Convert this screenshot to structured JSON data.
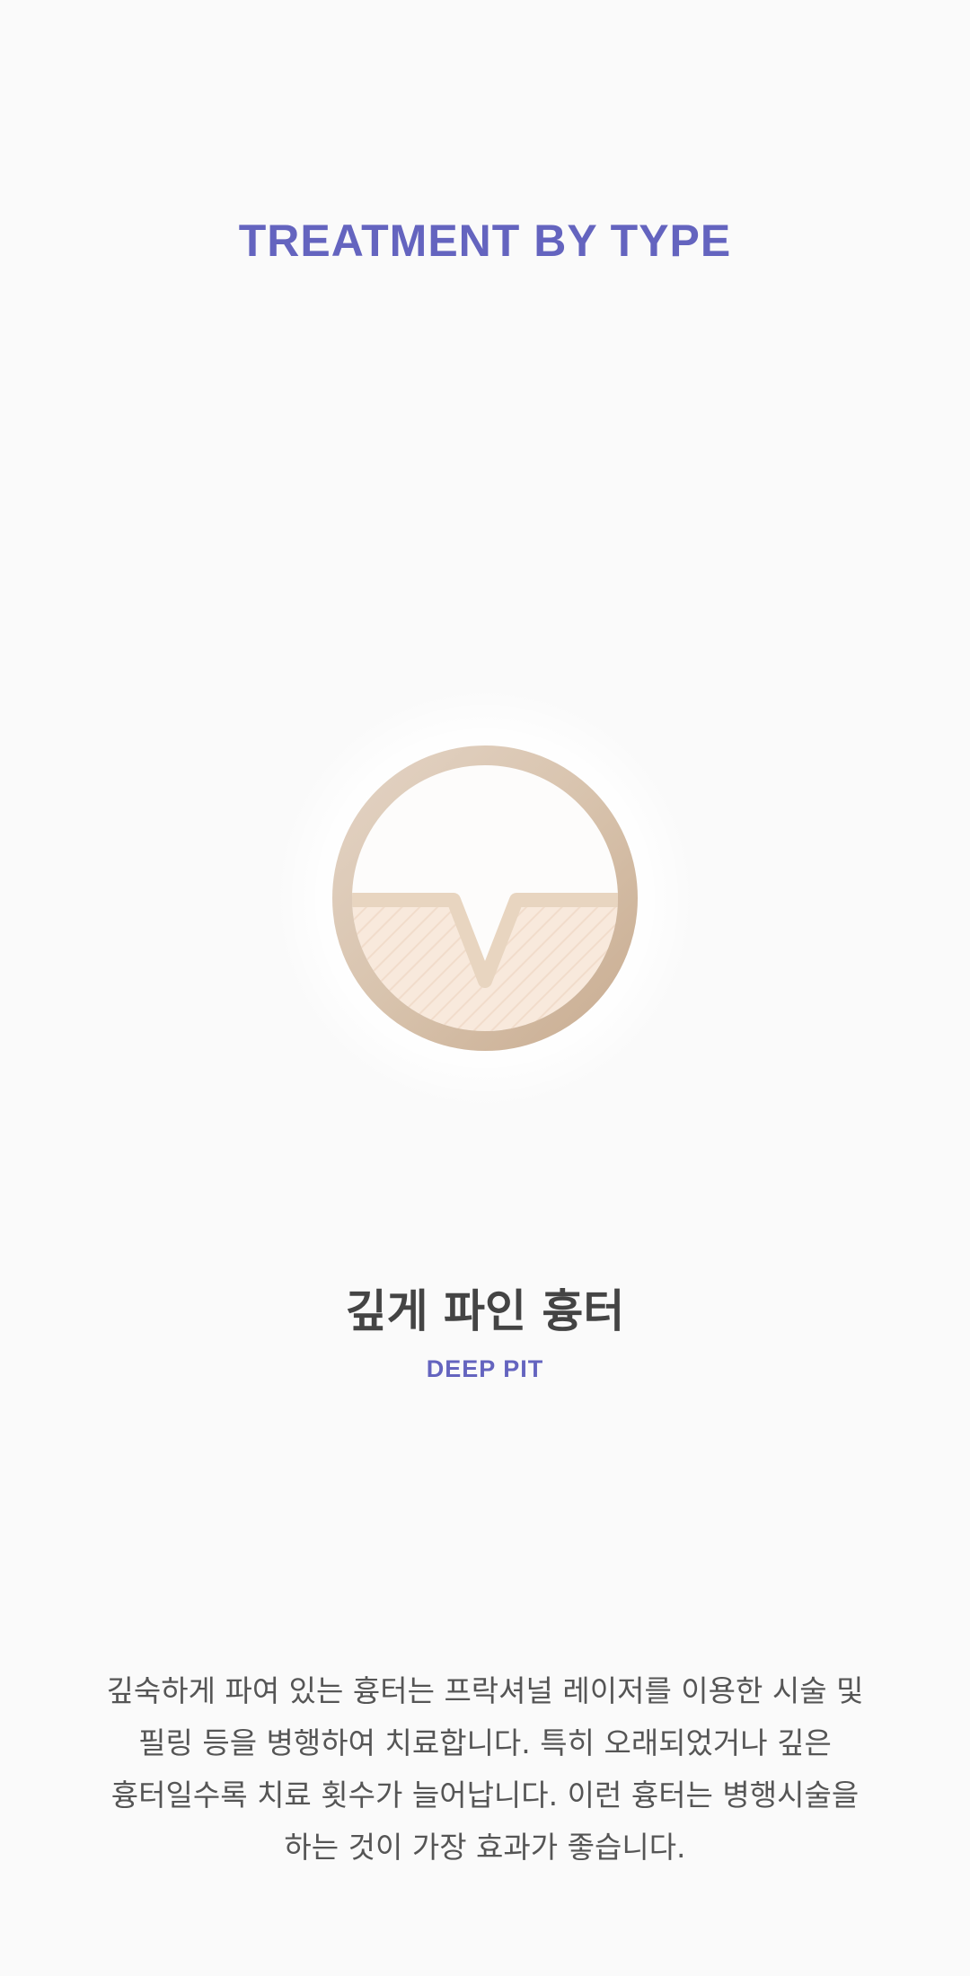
{
  "header": {
    "title": "TREATMENT BY TYPE"
  },
  "scar_type": {
    "icon": "deep-pit-scar-icon",
    "name_ko": "깊게 파인 흉터",
    "name_en": "DEEP PIT"
  },
  "description": {
    "lines": [
      "깊숙하게 파여 있는 흉터는 프락셔널 레이저를 이용한 시술 및",
      "필링 등을 병행하여 치료합니다. 특히 오래되었거나 깊은",
      "흉터일수록 치료 횟수가 늘어납니다. 이런 흉터는 병행시술을",
      "하는 것이 가장 효과가 좋습니다."
    ]
  },
  "colors": {
    "accent": "#6464bf",
    "heading_text": "#444444",
    "body_text": "#555555",
    "icon_ring": "#d9c4ac",
    "icon_fill": "#f7e6d8",
    "background": "#fafafa"
  }
}
